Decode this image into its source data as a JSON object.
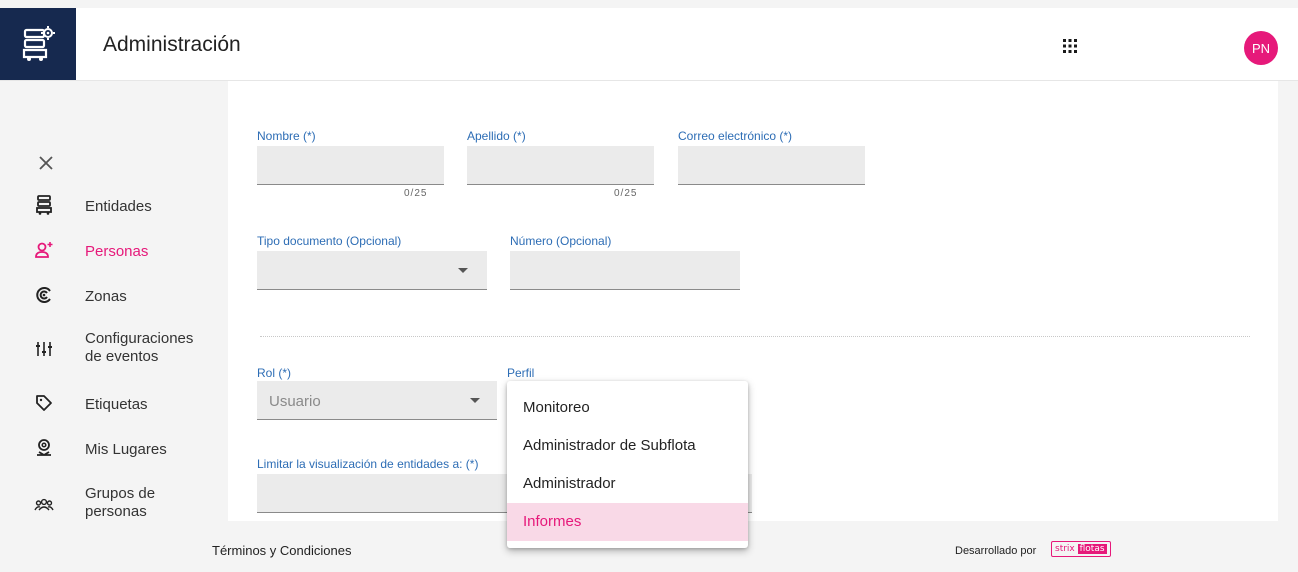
{
  "header": {
    "title": "Administración",
    "avatar_initials": "PN",
    "logo_icon": "fleet-admin-icon",
    "apps_icon": "apps-grid-icon"
  },
  "sidebar": {
    "close_icon": "close-icon",
    "items": [
      {
        "label": "Entidades",
        "icon": "vehicle-icon",
        "active": false
      },
      {
        "label": "Personas",
        "icon": "person-add-icon",
        "active": true
      },
      {
        "label": "Zonas",
        "icon": "zones-icon",
        "active": false
      },
      {
        "label": "Configuraciones de eventos",
        "icon": "sliders-icon",
        "active": false
      },
      {
        "label": "Etiquetas",
        "icon": "tag-icon",
        "active": false
      },
      {
        "label": "Mis Lugares",
        "icon": "place-pin-icon",
        "active": false
      },
      {
        "label": "Grupos de personas",
        "icon": "group-icon",
        "active": false
      }
    ]
  },
  "form": {
    "nombre": {
      "label": "Nombre (*)",
      "value": "",
      "counter": "0/25"
    },
    "apellido": {
      "label": "Apellido (*)",
      "value": "",
      "counter": "0/25"
    },
    "correo": {
      "label": "Correo electrónico (*)",
      "value": ""
    },
    "tipo_documento": {
      "label": "Tipo documento (Opcional)",
      "value": ""
    },
    "numero": {
      "label": "Número (Opcional)",
      "value": ""
    },
    "rol": {
      "label": "Rol (*)",
      "value": "Usuario"
    },
    "perfil": {
      "label": "Perfil",
      "value": ""
    },
    "limitar": {
      "label": "Limitar la visualización de entidades a: (*)",
      "value": ""
    }
  },
  "perfil_dropdown": {
    "options": [
      "Monitoreo",
      "Administrador de Subflota",
      "Administrador",
      "Informes"
    ],
    "highlighted": "Informes"
  },
  "footer": {
    "terms": "Términos y Condiciones",
    "developed_by": "Desarrollado por",
    "brand_a": "strix",
    "brand_b": "flotas"
  },
  "colors": {
    "brand_navy": "#16294f",
    "accent_pink": "#e6197a",
    "label_blue": "#2d6db5",
    "highlight_bg": "#f9d9e7"
  }
}
